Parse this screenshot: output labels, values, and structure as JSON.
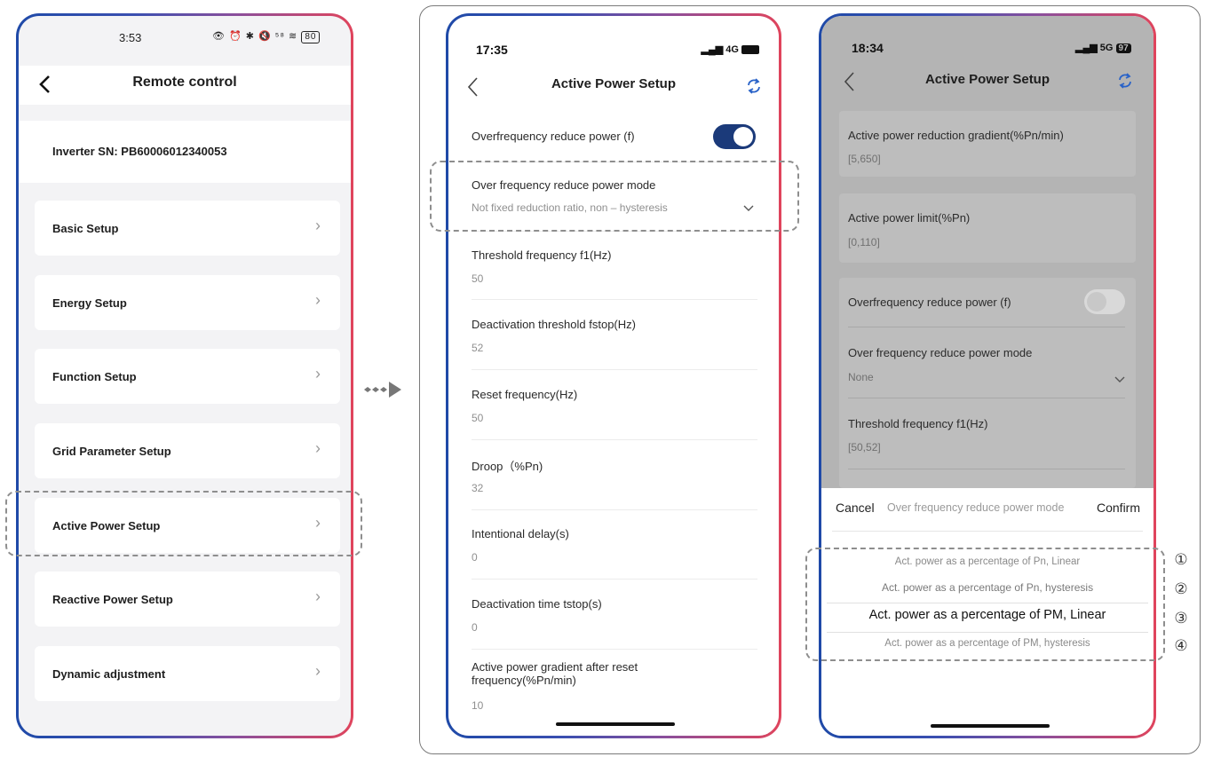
{
  "colors": {
    "accent": "#1b3a7a",
    "frame_left": "#1f4aa8",
    "frame_right": "#e0445c",
    "refresh": "#2a63c8"
  },
  "phone1": {
    "status_time": "3:53",
    "status_icons": "👁 ⏰ ✱ 🔇 ⁵⁸ ≋",
    "battery": "80",
    "title": "Remote control",
    "inverter_sn": "Inverter SN: PB60006012340053",
    "menu": [
      {
        "label": "Basic Setup"
      },
      {
        "label": "Energy Setup"
      },
      {
        "label": "Function Setup"
      },
      {
        "label": "Grid Parameter Setup"
      },
      {
        "label": "Active Power Setup"
      },
      {
        "label": "Reactive Power Setup"
      },
      {
        "label": "Dynamic adjustment"
      }
    ]
  },
  "arrow": "⋄⋄⋄▶",
  "phone2": {
    "status_time": "17:35",
    "network": "4G",
    "title": "Active Power Setup",
    "overfreq_toggle_label": "Overfrequency reduce power (f)",
    "overfreq_toggle_on": true,
    "rows": [
      {
        "label": "Over frequency reduce power mode",
        "value": "Not fixed reduction ratio, non – hysteresis"
      },
      {
        "label": "Threshold frequency f1(Hz)",
        "value": "50"
      },
      {
        "label": "Deactivation threshold fstop(Hz)",
        "value": "52"
      },
      {
        "label": "Reset frequency(Hz)",
        "value": "50"
      },
      {
        "label": "Droop（%Pn)",
        "value": "32"
      },
      {
        "label": "Intentional delay(s)",
        "value": "0"
      },
      {
        "label": "Deactivation time tstop(s)",
        "value": "0"
      },
      {
        "label": "Active power gradient after reset frequency(%Pn/min)",
        "value": "10"
      }
    ]
  },
  "phone3": {
    "status_time": "18:34",
    "network": "5G",
    "battery": "97",
    "title": "Active Power Setup",
    "cards": [
      {
        "label": "Active power reduction gradient(%Pn/min)",
        "value": "[5,650]"
      },
      {
        "label": "Active power limit(%Pn)",
        "value": "[0,110]"
      }
    ],
    "overfreq_toggle_label": "Overfrequency reduce power (f)",
    "overfreq_toggle_on": false,
    "mode_label": "Over frequency reduce power mode",
    "mode_value": "None",
    "threshold_label": "Threshold frequency f1(Hz)",
    "threshold_value": "[50,52]",
    "picker": {
      "cancel": "Cancel",
      "title": "Over frequency reduce power mode",
      "confirm": "Confirm",
      "options": [
        "Act. power as a percentage of Pn, Linear",
        "Act. power as a percentage of Pn, hysteresis",
        "Act. power as a percentage of PM, Linear",
        "Act. power as a percentage of PM, hysteresis"
      ],
      "selected_index": 2
    },
    "markers": [
      "①",
      "②",
      "③",
      "④"
    ]
  }
}
